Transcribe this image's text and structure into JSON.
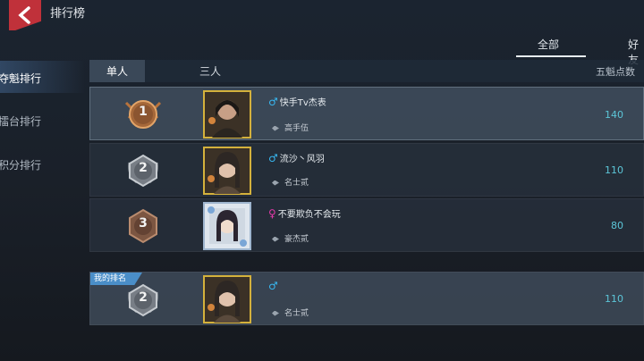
{
  "header": {
    "title": "排行榜"
  },
  "filter_tabs": [
    "全部",
    "好友"
  ],
  "sidebar": {
    "items": [
      "夺魁排行",
      "擂台排行",
      "积分排行"
    ]
  },
  "segment_tabs": [
    "单人",
    "三人"
  ],
  "score_header": "五魁点数",
  "rows": [
    {
      "rank": "1",
      "name": "快手Tv杰表",
      "gender": "male",
      "gender_symbol": "♂",
      "title": "高手伍",
      "score": "140"
    },
    {
      "rank": "2",
      "name": "流沙丶风羽",
      "gender": "male",
      "gender_symbol": "♂",
      "title": "名士贰",
      "score": "110"
    },
    {
      "rank": "3",
      "name": "不要欺负不会玩",
      "gender": "female",
      "gender_symbol": "♀",
      "title": "豪杰贰",
      "score": "80"
    }
  ],
  "my_rank": {
    "tag": "我的排名",
    "rank": "2",
    "name": "",
    "gender_symbol": "♂",
    "title": "名士贰",
    "score": "110"
  },
  "colors": {
    "back_button": "#c0313a",
    "score": "#5cc6d8",
    "male": "#38b7f0",
    "female": "#e03aa8",
    "my_rank_tag": "#4a8ec8"
  }
}
